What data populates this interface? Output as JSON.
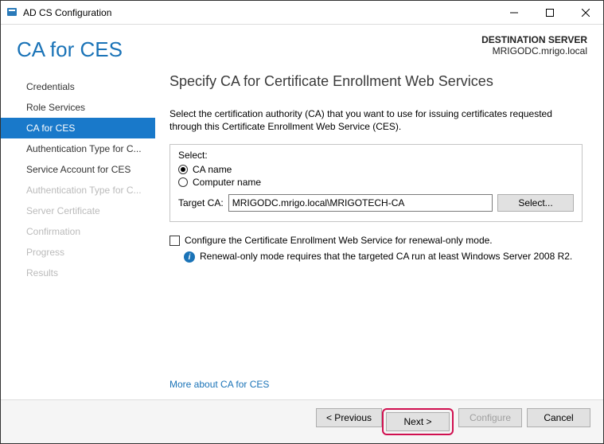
{
  "window": {
    "title": "AD CS Configuration"
  },
  "header": {
    "page_title": "CA for CES",
    "destination_label": "DESTINATION SERVER",
    "destination_server": "MRIGODC.mrigo.local"
  },
  "sidebar": {
    "items": [
      {
        "label": "Credentials",
        "state": "normal"
      },
      {
        "label": "Role Services",
        "state": "normal"
      },
      {
        "label": "CA for CES",
        "state": "selected"
      },
      {
        "label": "Authentication Type for C...",
        "state": "normal"
      },
      {
        "label": "Service Account for CES",
        "state": "normal"
      },
      {
        "label": "Authentication Type for C...",
        "state": "disabled"
      },
      {
        "label": "Server Certificate",
        "state": "disabled"
      },
      {
        "label": "Confirmation",
        "state": "disabled"
      },
      {
        "label": "Progress",
        "state": "disabled"
      },
      {
        "label": "Results",
        "state": "disabled"
      }
    ]
  },
  "main": {
    "heading": "Specify CA for Certificate Enrollment Web Services",
    "description": "Select the certification authority (CA) that you want to use for issuing certificates requested through this Certificate Enrollment Web Service (CES).",
    "select_block": {
      "label": "Select:",
      "option_ca_name": "CA name",
      "option_computer_name": "Computer name",
      "selected": "ca_name",
      "target_ca_label": "Target CA:",
      "target_ca_value": "MRIGODC.mrigo.local\\MRIGOTECH-CA",
      "select_button": "Select..."
    },
    "renewal_checkbox_label": "Configure the Certificate Enrollment Web Service for renewal-only mode.",
    "renewal_checked": false,
    "renewal_info": "Renewal-only mode requires that the targeted CA run at least Windows Server 2008 R2.",
    "more_link": "More about CA for CES"
  },
  "footer": {
    "previous": "< Previous",
    "next": "Next >",
    "configure": "Configure",
    "cancel": "Cancel",
    "configure_enabled": false
  }
}
